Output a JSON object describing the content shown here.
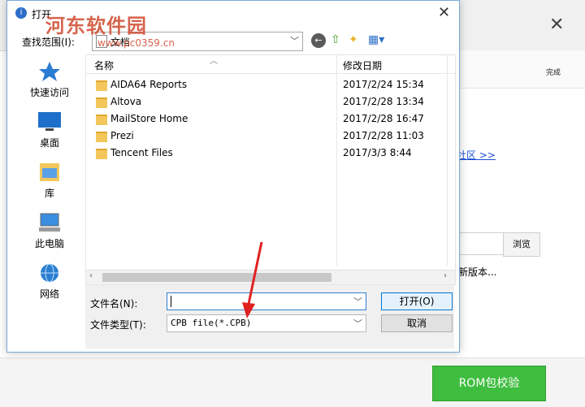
{
  "background": {
    "done_label": "完成",
    "community_link": "社区 >>",
    "browse_label": "浏览",
    "new_version_text": "新版本...",
    "rom_button": "ROM包校验"
  },
  "watermark": {
    "title": "河东软件园",
    "url": "www.pc0359.cn"
  },
  "dialog": {
    "title": "打开",
    "look_in_label": "查找范围(I):",
    "look_in_value": "文档",
    "sidebar": [
      {
        "label": "快速访问",
        "icon": "star-icon"
      },
      {
        "label": "桌面",
        "icon": "desktop-icon"
      },
      {
        "label": "库",
        "icon": "library-icon"
      },
      {
        "label": "此电脑",
        "icon": "computer-icon"
      },
      {
        "label": "网络",
        "icon": "network-icon"
      }
    ],
    "columns": {
      "name": "名称",
      "date": "修改日期"
    },
    "files": [
      {
        "name": "AIDA64 Reports",
        "date": "2017/2/24 15:34"
      },
      {
        "name": "Altova",
        "date": "2017/2/28 13:34"
      },
      {
        "name": "MailStore Home",
        "date": "2017/2/28 16:47"
      },
      {
        "name": "Prezi",
        "date": "2017/2/28 11:03"
      },
      {
        "name": "Tencent Files",
        "date": "2017/3/3 8:44"
      }
    ],
    "filename_label": "文件名(N):",
    "filename_value": "",
    "filetype_label": "文件类型(T):",
    "filetype_value": "CPB file(*.CPB)",
    "open_button": "打开(O)",
    "cancel_button": "取消"
  },
  "colors": {
    "rom_button_bg": "#3fbd3f",
    "accent_blue": "#0078d7",
    "annotation_arrow": "#e02020",
    "folder": "#f3c75b"
  }
}
